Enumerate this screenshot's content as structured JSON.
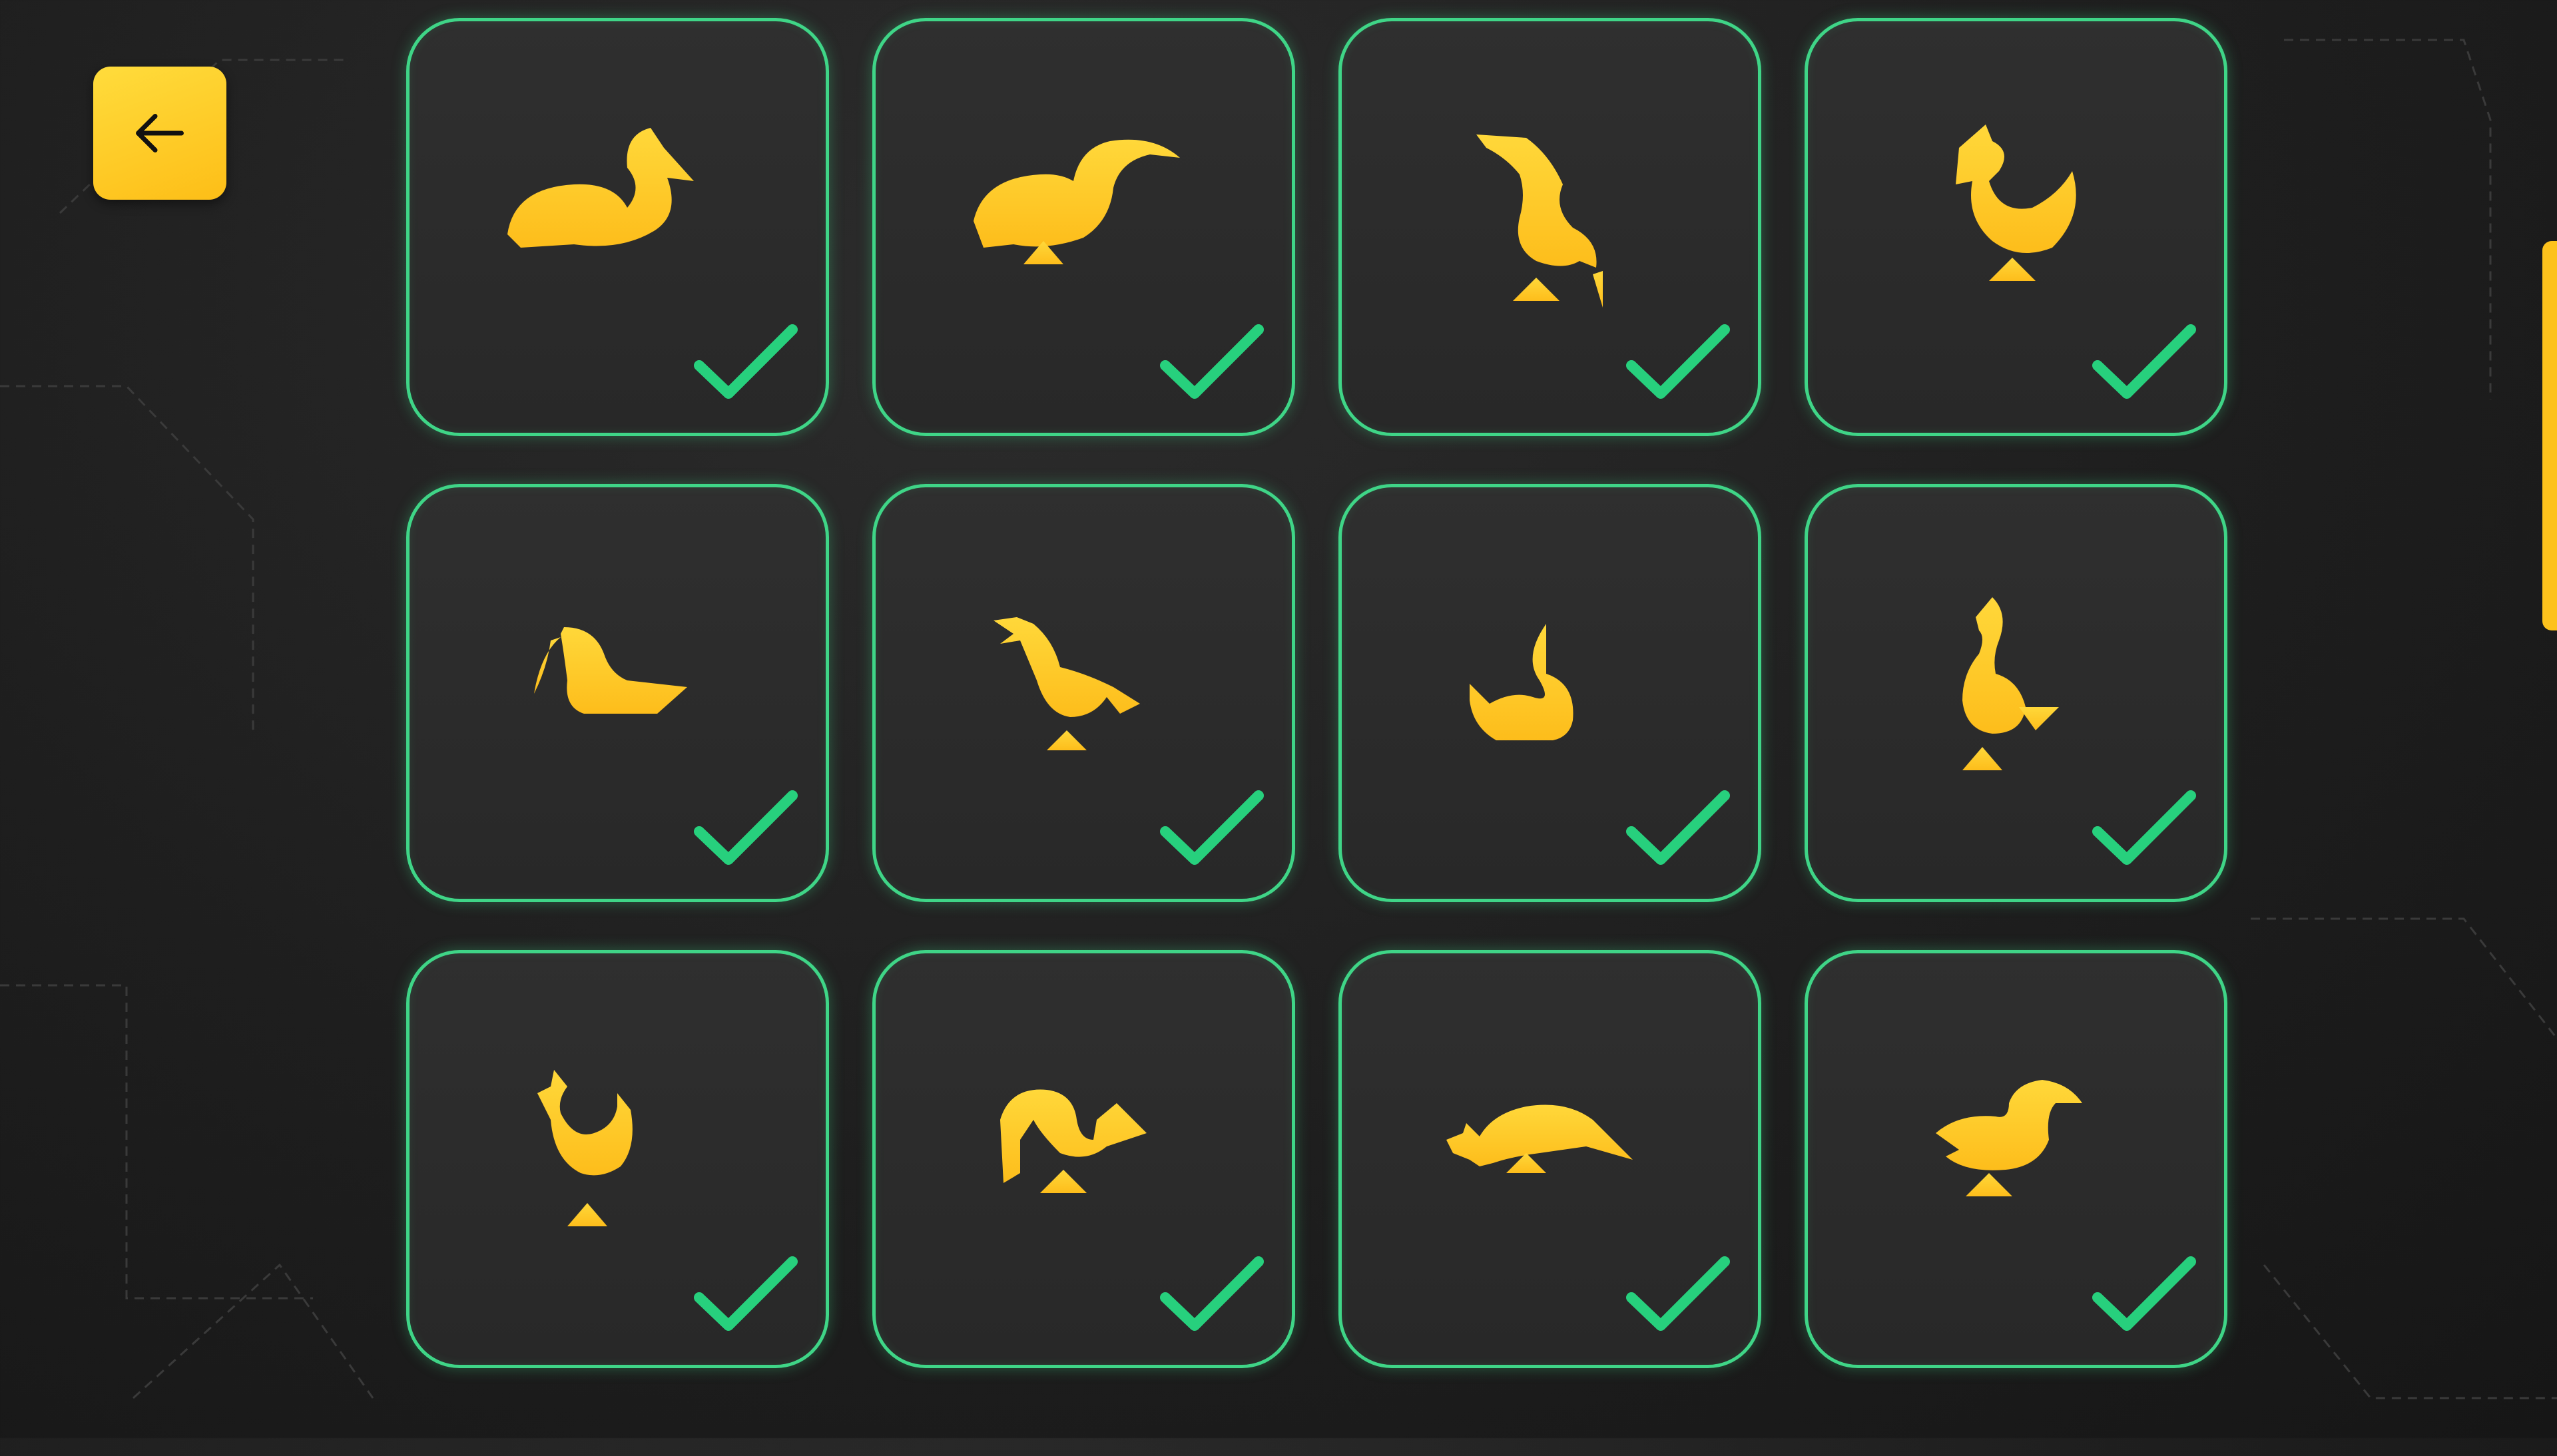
{
  "colors": {
    "accent": "#fdc21c",
    "complete": "#3fd587",
    "background": "#1e1e1e"
  },
  "navigation": {
    "back_icon": "arrow-left-icon"
  },
  "levels": [
    {
      "shape": "swan-resting",
      "completed": true
    },
    {
      "shape": "toucan",
      "completed": true
    },
    {
      "shape": "goose-reaching",
      "completed": true
    },
    {
      "shape": "bird-beak-up",
      "completed": true
    },
    {
      "shape": "pelican-sitting",
      "completed": true
    },
    {
      "shape": "crested-bird-walking",
      "completed": true
    },
    {
      "shape": "swan-curled",
      "completed": true
    },
    {
      "shape": "goose-standing",
      "completed": true
    },
    {
      "shape": "chick",
      "completed": true
    },
    {
      "shape": "bird-pecking",
      "completed": true
    },
    {
      "shape": "bird-flying-low",
      "completed": true
    },
    {
      "shape": "duck-standing",
      "completed": true
    }
  ]
}
